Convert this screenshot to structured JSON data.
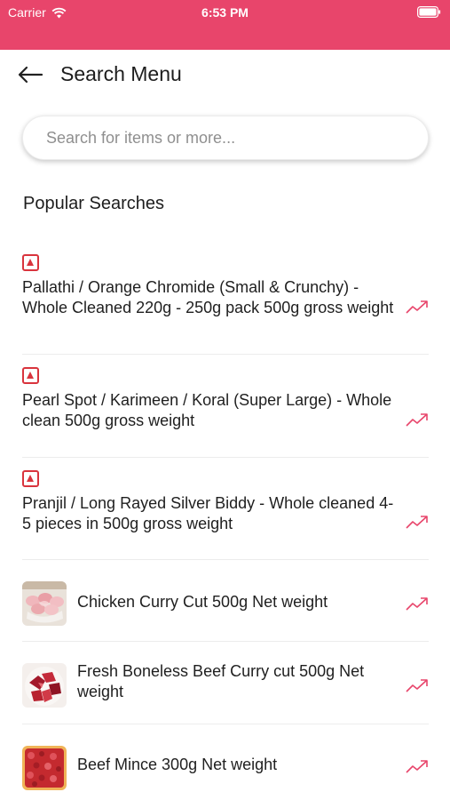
{
  "status_bar": {
    "carrier": "Carrier",
    "time": "6:53 PM",
    "bar_color": "#e8456b"
  },
  "header": {
    "title": "Search Menu"
  },
  "search": {
    "placeholder": "Search for items or more..."
  },
  "popular": {
    "title": "Popular Searches",
    "items": [
      {
        "name": "Pallathi / Orange Chromide (Small & Crunchy) - Whole Cleaned 220g - 250g pack 500g gross weight"
      },
      {
        "name": "Pearl Spot / Karimeen / Koral (Super Large) - Whole clean 500g gross weight"
      },
      {
        "name": "Pranjil / Long Rayed Silver Biddy - Whole cleaned 4-5 pieces in 500g gross weight"
      },
      {
        "name": "Chicken Curry Cut 500g Net weight"
      },
      {
        "name": "Fresh Boneless Beef Curry cut 500g Net weight"
      },
      {
        "name": "Beef Mince 300g Net weight"
      }
    ]
  },
  "colors": {
    "accent": "#e8456b",
    "nonveg_marker": "#d9343d",
    "trend_icon": "#e8456b"
  }
}
